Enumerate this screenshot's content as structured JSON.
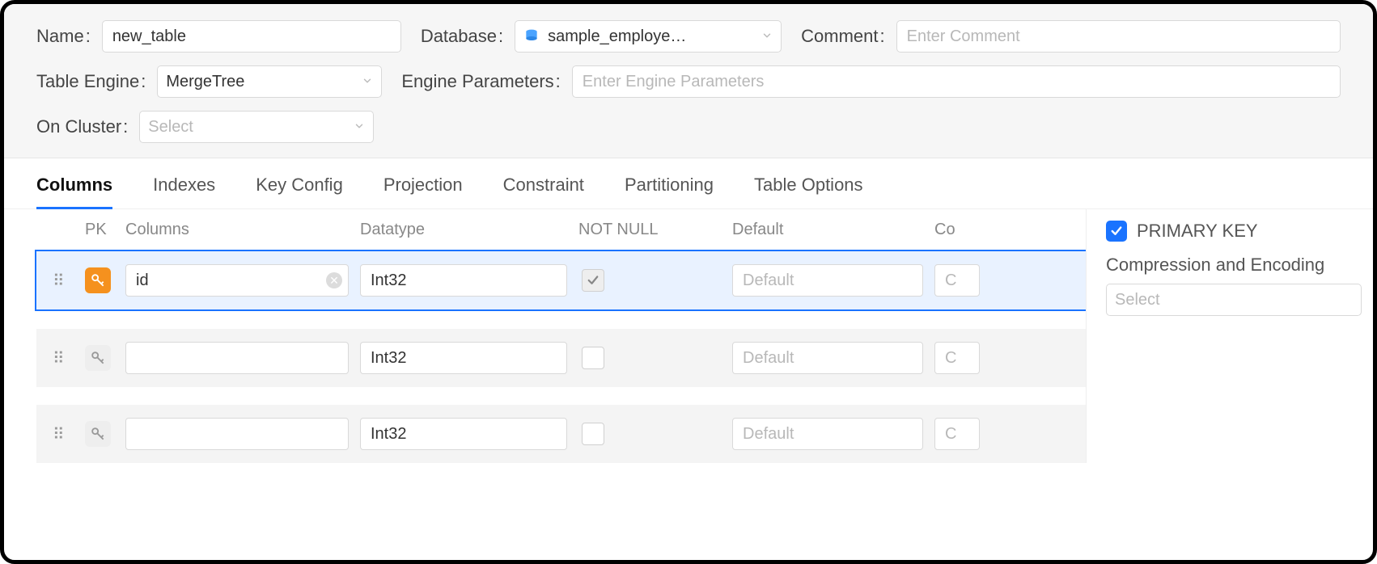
{
  "top": {
    "name_label": "Name",
    "name_value": "new_table",
    "database_label": "Database",
    "database_value": "sample_employe…",
    "comment_label": "Comment",
    "comment_placeholder": "Enter Comment",
    "engine_label": "Table Engine",
    "engine_value": "MergeTree",
    "engine_params_label": "Engine Parameters",
    "engine_params_placeholder": "Enter Engine Parameters",
    "oncluster_label": "On Cluster",
    "oncluster_placeholder": "Select"
  },
  "tabs": {
    "columns": "Columns",
    "indexes": "Indexes",
    "keyconfig": "Key Config",
    "projection": "Projection",
    "constraint": "Constraint",
    "partitioning": "Partitioning",
    "tableoptions": "Table Options"
  },
  "grid": {
    "hdr_pk": "PK",
    "hdr_columns": "Columns",
    "hdr_datatype": "Datatype",
    "hdr_notnull": "NOT NULL",
    "hdr_default": "Default",
    "hdr_co": "Co",
    "default_ph": "Default",
    "co_ph": "C",
    "rows": [
      {
        "pk": true,
        "name": "id",
        "datatype": "Int32",
        "notnull": true,
        "selected": true
      },
      {
        "pk": false,
        "name": "",
        "datatype": "Int32",
        "notnull": false,
        "selected": false
      },
      {
        "pk": false,
        "name": "",
        "datatype": "Int32",
        "notnull": false,
        "selected": false
      }
    ]
  },
  "side": {
    "pk_label": "PRIMARY KEY",
    "pk_checked": true,
    "comp_label": "Compression and Encoding",
    "comp_placeholder": "Select"
  }
}
